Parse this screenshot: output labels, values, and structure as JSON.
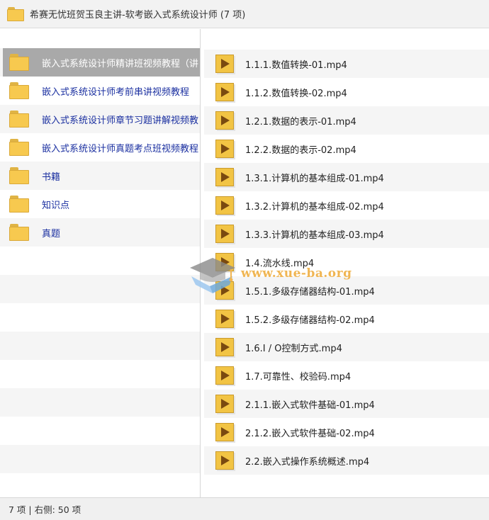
{
  "window": {
    "title": "希赛无忧班贺玉良主讲-软考嵌入式系统设计师 (7 项)"
  },
  "left_pane": {
    "items": [
      {
        "label": "嵌入式系统设计师精讲班视频教程（讲",
        "icon": "folder-icon",
        "selected": true
      },
      {
        "label": "嵌入式系统设计师考前串讲视频教程",
        "icon": "folder-icon"
      },
      {
        "label": "嵌入式系统设计师章节习题讲解视频教",
        "icon": "folder-icon"
      },
      {
        "label": "嵌入式系统设计师真题考点班视频教程",
        "icon": "folder-icon"
      },
      {
        "label": "书籍",
        "icon": "folder-icon"
      },
      {
        "label": "知识点",
        "icon": "folder-icon"
      },
      {
        "label": "真题",
        "icon": "folder-icon"
      }
    ]
  },
  "right_pane": {
    "items": [
      {
        "label": "1.1.1.数值转换-01.mp4",
        "icon": "video-file-icon"
      },
      {
        "label": "1.1.2.数值转换-02.mp4",
        "icon": "video-file-icon"
      },
      {
        "label": "1.2.1.数据的表示-01.mp4",
        "icon": "video-file-icon"
      },
      {
        "label": "1.2.2.数据的表示-02.mp4",
        "icon": "video-file-icon"
      },
      {
        "label": "1.3.1.计算机的基本组成-01.mp4",
        "icon": "video-file-icon"
      },
      {
        "label": "1.3.2.计算机的基本组成-02.mp4",
        "icon": "video-file-icon"
      },
      {
        "label": "1.3.3.计算机的基本组成-03.mp4",
        "icon": "video-file-icon"
      },
      {
        "label": "1.4.流水线.mp4",
        "icon": "video-file-icon"
      },
      {
        "label": "1.5.1.多级存储器结构-01.mp4",
        "icon": "video-file-icon"
      },
      {
        "label": "1.5.2.多级存储器结构-02.mp4",
        "icon": "video-file-icon"
      },
      {
        "label": "1.6.I / O控制方式.mp4",
        "icon": "video-file-icon"
      },
      {
        "label": "1.7.可靠性、校验码.mp4",
        "icon": "video-file-icon"
      },
      {
        "label": "2.1.1.嵌入式软件基础-01.mp4",
        "icon": "video-file-icon"
      },
      {
        "label": "2.1.2.嵌入式软件基础-02.mp4",
        "icon": "video-file-icon"
      },
      {
        "label": "2.2.嵌入式操作系统概述.mp4",
        "icon": "video-file-icon"
      }
    ]
  },
  "watermark": {
    "text": "www.xue-ba.org",
    "icon": "graduation-cap-icon",
    "color": "#f0b552"
  },
  "statusbar": {
    "text": "7 项 | 右侧: 50 项"
  },
  "colors": {
    "folder": "#f7c94f",
    "video_icon": "#f2c444",
    "selected_row": "#a9a9a9",
    "folder_label": "#1a2fa0"
  }
}
